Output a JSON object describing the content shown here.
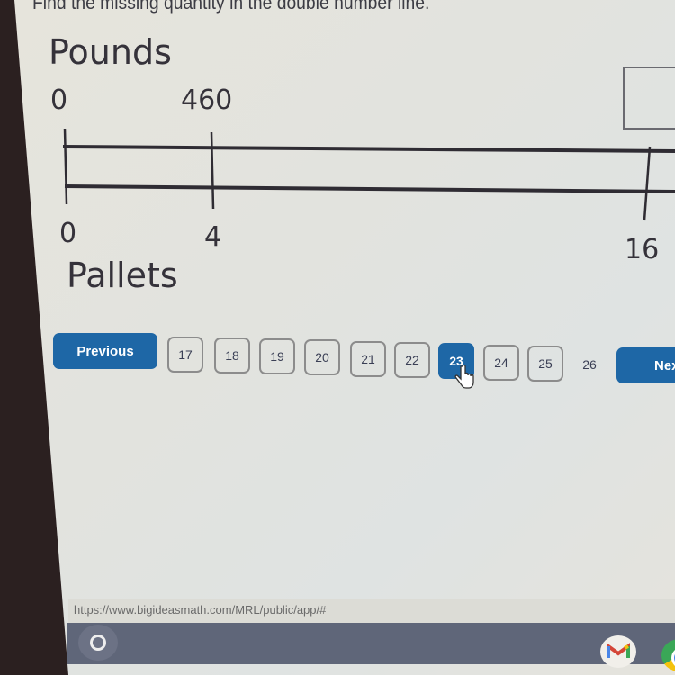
{
  "instruction": "Find the missing quantity in the double number line.",
  "double_number_line": {
    "top_label": "Pounds",
    "bottom_label": "Pallets",
    "top_ticks": [
      "0",
      "460",
      ""
    ],
    "bottom_ticks": [
      "0",
      "4",
      "16"
    ],
    "answer_placeholder": ""
  },
  "pagination": {
    "previous_label": "Previous",
    "next_label": "Next",
    "pages": [
      "17",
      "18",
      "19",
      "20",
      "21",
      "22",
      "23",
      "24",
      "25",
      "26"
    ],
    "current_page": "23"
  },
  "status_url": "https://www.bigideasmath.com/MRL/public/app/#",
  "taskbar": {
    "icons": [
      "launcher-icon",
      "gmail-icon",
      "chrome-icon"
    ]
  },
  "colors": {
    "accent": "#1e67a6",
    "text": "#35323a"
  }
}
